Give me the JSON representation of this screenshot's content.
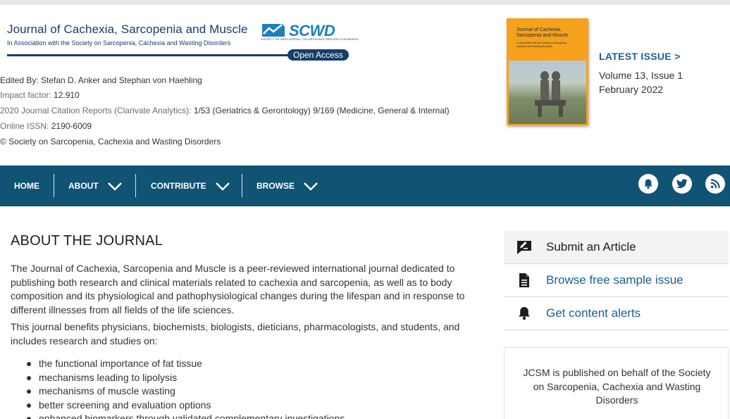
{
  "journal": {
    "title": "Journal of Cachexia, Sarcopenia and Muscle",
    "subtitle": "In Association with the Society on Sarcopenia, Cachexia and Wasting Disorders",
    "partner_logo": "SCWD",
    "partner_tagline": "SOCIETY ON SARCOPENIA, CACHEXIA AND WASTING DISORDERS",
    "access_badge": "Open Access"
  },
  "meta": {
    "edited_by": "Edited By: Stefan D. Anker and Stephan von Haehling",
    "impact_label": "Impact factor:",
    "impact_value": "12.910",
    "jcr_label": "2020 Journal Citation Reports (Clarivate Analytics):",
    "jcr_value": "1/53 (Geriatrics & Gerontology)  9/169 (Medicine, General & Internal)",
    "issn_label": "Online ISSN:",
    "issn_value": "2190-6009",
    "copyright": "© Society on Sarcopenia, Cachexia and Wasting Disorders"
  },
  "cover": {
    "title": "Journal of Cachexia, Sarcopenia and Muscle",
    "subtitle": "In Association with the Society on Sarcopenia, Cachexia and Wasting Disorders",
    "publisher": "WILEY"
  },
  "latest_issue": {
    "link_label": "LATEST ISSUE  >",
    "volume": "Volume 13, Issue 1",
    "date": "February 2022"
  },
  "nav": {
    "items": [
      {
        "label": "HOME"
      },
      {
        "label": "ABOUT"
      },
      {
        "label": "CONTRIBUTE"
      },
      {
        "label": "BROWSE"
      }
    ],
    "icons": [
      "bell-icon",
      "twitter-icon",
      "rss-icon"
    ],
    "bg_color": "#115373"
  },
  "main": {
    "heading": "ABOUT THE JOURNAL",
    "para1": "The Journal of Cachexia, Sarcopenia and Muscle is a peer-reviewed international journal dedicated to publishing both research and clinical materials related to cachexia and sarcopenia, as well as to body composition and its physiological and pathophysiological changes during the lifespan and in response to different illnesses from all fields of the life sciences.",
    "para2": "This journal benefits physicians, biochemists, biologists, dieticians, pharmacologists, and students, and includes research and studies on:",
    "bullets": [
      "the functional importance of fat tissue",
      "mechanisms leading to lipolysis",
      "mechanisms of muscle wasting",
      "better screening and evaluation options",
      "enhanced biomarkers through validated complementary investigations"
    ]
  },
  "sidebar": {
    "links": [
      {
        "label": "Submit an Article",
        "icon": "edit-icon"
      },
      {
        "label": "Browse free sample issue",
        "icon": "document-icon"
      },
      {
        "label": "Get content alerts",
        "icon": "bell-icon"
      }
    ],
    "note": "JCSM is published on behalf of the Society on Sarcopenia, Cachexia and Wasting Disorders",
    "link_color": "#1b5f91"
  }
}
